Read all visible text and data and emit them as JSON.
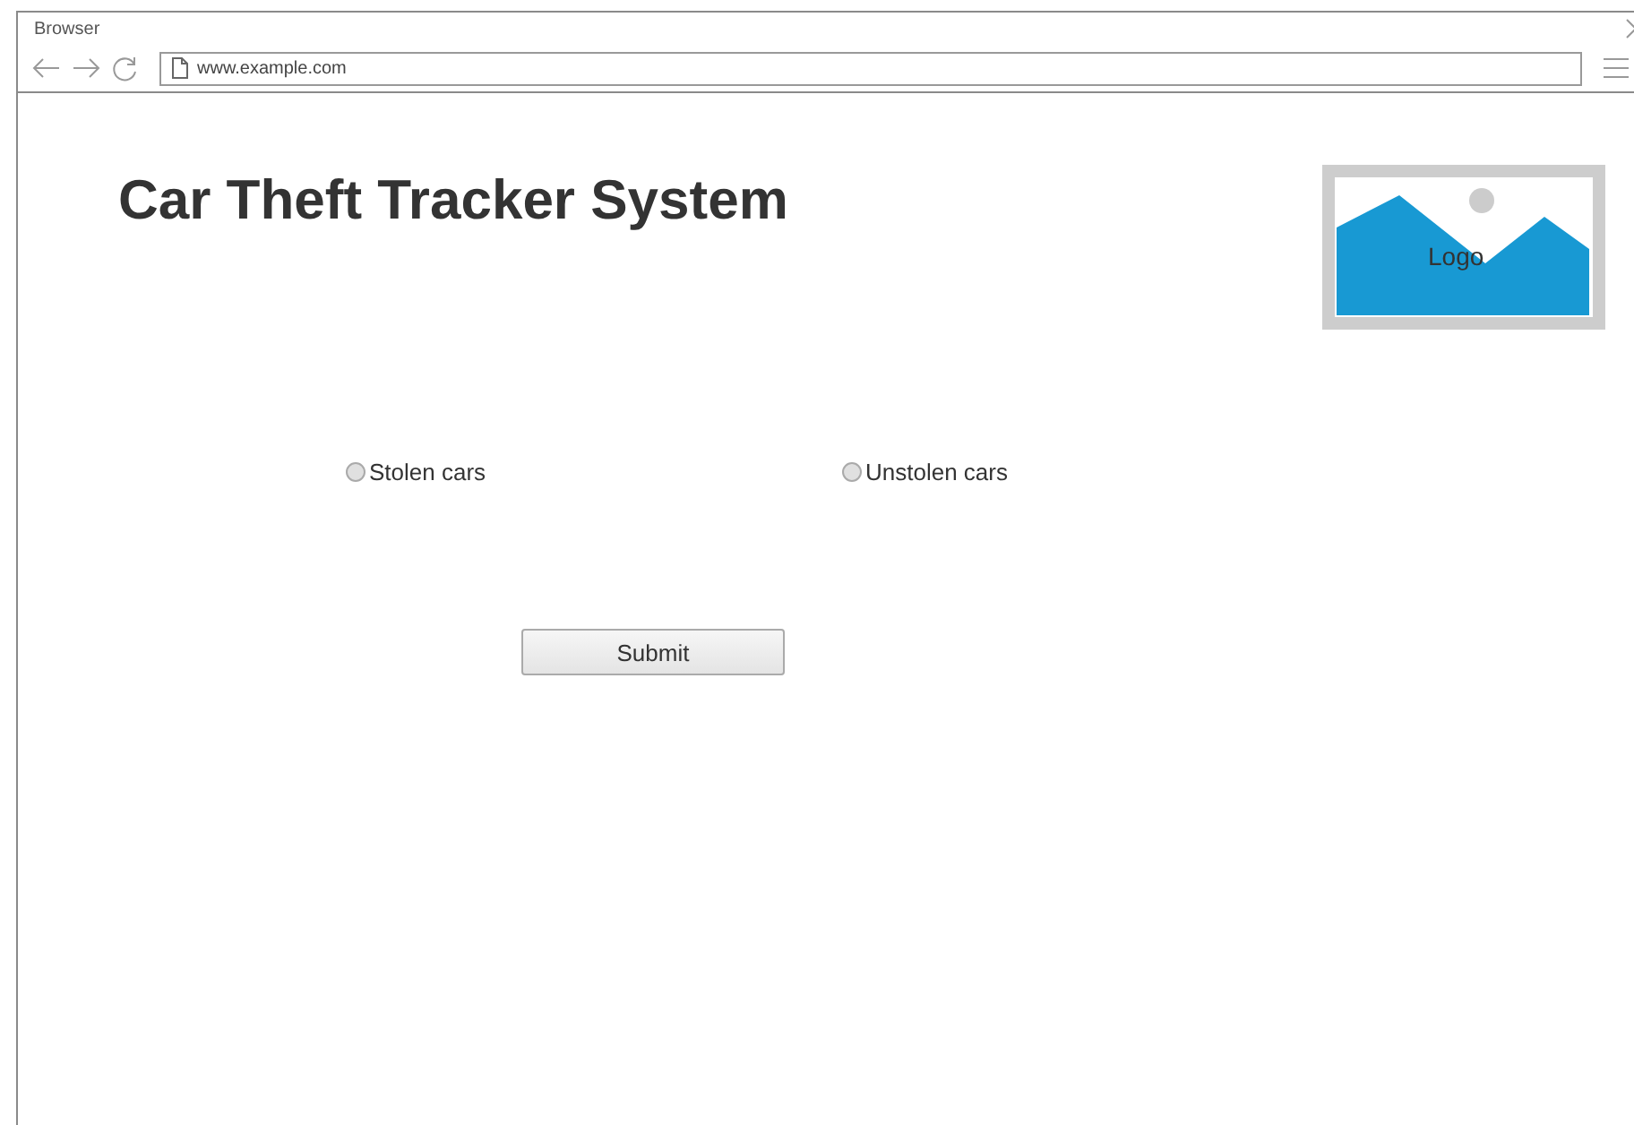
{
  "browser": {
    "title": "Browser",
    "url": "www.example.com"
  },
  "page": {
    "heading": "Car Theft Tracker System",
    "logo": {
      "label": "Logo"
    },
    "options": [
      {
        "label": "Stolen cars",
        "selected": false
      },
      {
        "label": "Unstolen cars",
        "selected": false
      }
    ],
    "submit": "Submit"
  }
}
